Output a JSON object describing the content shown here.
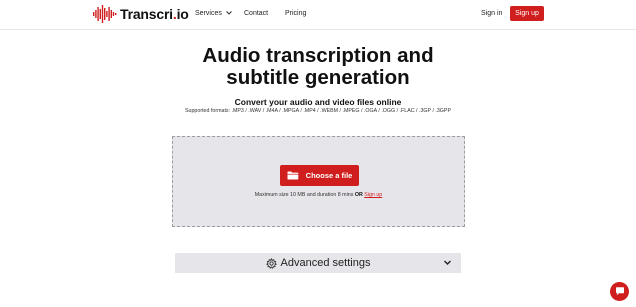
{
  "brand": {
    "name_main": "Transcri",
    "name_dot": ".",
    "name_tld": "io",
    "color": "#d01d1d"
  },
  "nav": {
    "services": "Services",
    "contact": "Contact",
    "pricing": "Pricing",
    "sign_in": "Sign in",
    "sign_up": "Sign up"
  },
  "hero": {
    "title_line1": "Audio transcription and",
    "title_line2": "subtitle generation",
    "subtitle": "Convert your audio and video files online",
    "formats": "Supported formats: .MP3 / .WAV / .M4A / .MPGA / .MP4 / .WEBM / .MPEG / .OGA / .OGG / .FLAC / .3GP / .3GPP"
  },
  "upload": {
    "button_label": "Choose a file",
    "note_prefix": "Maximum size 10 MB and duration 8 mins",
    "note_or": "OR",
    "note_link": "Sign up"
  },
  "advanced": {
    "label": "Advanced settings"
  },
  "icons": {
    "logo": "sound-wave-icon",
    "services_chevron": "chevron-down-icon",
    "choose": "folder-icon",
    "advanced": "gear-icon",
    "advanced_chevron": "chevron-down-icon",
    "chat": "chat-bubble-icon"
  }
}
